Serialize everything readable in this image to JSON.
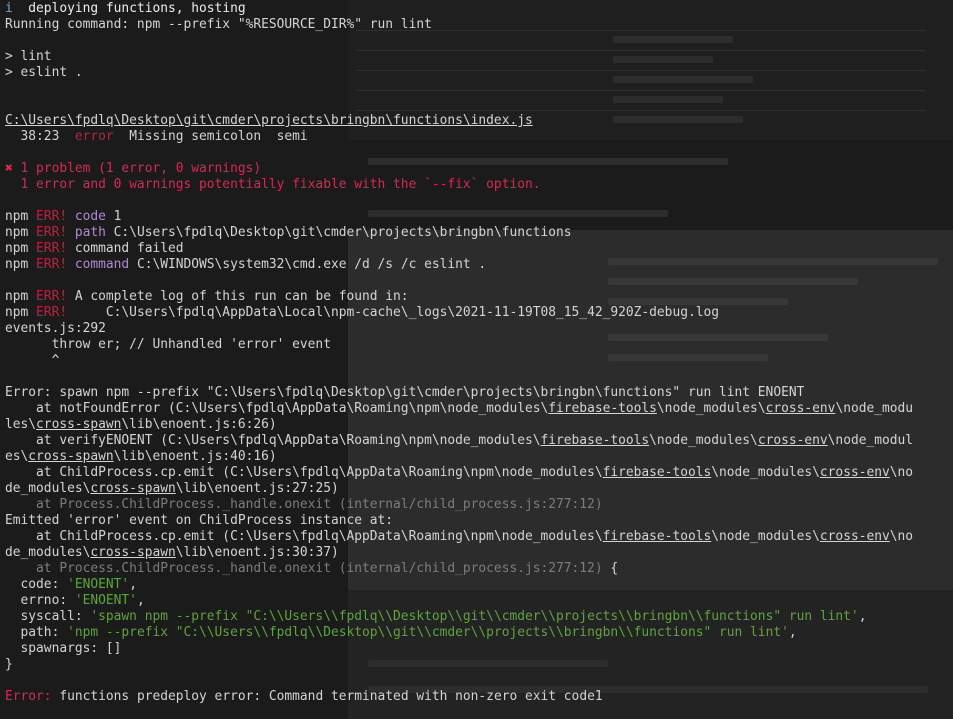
{
  "terminal": {
    "lines": [
      [
        {
          "t": "i",
          "c": "cyan"
        },
        {
          "t": "  deploying ",
          "c": "white"
        },
        {
          "t": "functions, hosting",
          "c": "white"
        }
      ],
      [
        {
          "t": "Running command: npm --prefix \"%RESOURCE_DIR%\" run lint",
          "c": "default"
        }
      ],
      [],
      [
        {
          "t": "> lint",
          "c": "default"
        }
      ],
      [
        {
          "t": "> eslint .",
          "c": "default"
        }
      ],
      [],
      [],
      [
        {
          "t": "C:\\Users\\fpdlq\\Desktop\\git\\cmder\\projects\\bringbn\\functions\\index.js",
          "c": "default",
          "u": true
        }
      ],
      [
        {
          "t": "  38:23  ",
          "c": "default"
        },
        {
          "t": "error",
          "c": "dimred"
        },
        {
          "t": "  Missing semicolon  semi",
          "c": "default"
        }
      ],
      [],
      [
        {
          "t": "✖ 1 problem (1 error, 0 warnings)",
          "c": "red"
        }
      ],
      [
        {
          "t": "  1 error and 0 warnings potentially fixable with the `--fix` option.",
          "c": "red"
        }
      ],
      [],
      [
        {
          "t": "npm ",
          "c": "default"
        },
        {
          "t": "ERR!",
          "c": "dimred"
        },
        {
          "t": " ",
          "c": "default"
        },
        {
          "t": "code",
          "c": "purple"
        },
        {
          "t": " 1",
          "c": "default"
        }
      ],
      [
        {
          "t": "npm ",
          "c": "default"
        },
        {
          "t": "ERR!",
          "c": "dimred"
        },
        {
          "t": " ",
          "c": "default"
        },
        {
          "t": "path",
          "c": "purple"
        },
        {
          "t": " C:\\Users\\fpdlq\\Desktop\\git\\cmder\\projects\\bringbn\\functions",
          "c": "default"
        }
      ],
      [
        {
          "t": "npm ",
          "c": "default"
        },
        {
          "t": "ERR!",
          "c": "dimred"
        },
        {
          "t": " command failed",
          "c": "default"
        }
      ],
      [
        {
          "t": "npm ",
          "c": "default"
        },
        {
          "t": "ERR!",
          "c": "dimred"
        },
        {
          "t": " ",
          "c": "default"
        },
        {
          "t": "command",
          "c": "purple"
        },
        {
          "t": " C:\\WINDOWS\\system32\\cmd.exe /d /s /c eslint .",
          "c": "default"
        }
      ],
      [],
      [
        {
          "t": "npm ",
          "c": "default"
        },
        {
          "t": "ERR!",
          "c": "dimred"
        },
        {
          "t": " A complete log of this run can be found in:",
          "c": "default"
        }
      ],
      [
        {
          "t": "npm ",
          "c": "default"
        },
        {
          "t": "ERR!",
          "c": "dimred"
        },
        {
          "t": "     C:\\Users\\fpdlq\\AppData\\Local\\npm-cache\\_logs\\2021-11-19T08_15_42_920Z-debug.log",
          "c": "default"
        }
      ],
      [
        {
          "t": "events.js:292",
          "c": "default"
        }
      ],
      [
        {
          "t": "      throw er; // Unhandled 'error' event",
          "c": "default"
        }
      ],
      [
        {
          "t": "      ^",
          "c": "default"
        }
      ],
      [],
      [
        {
          "t": "Error: spawn npm --prefix \"C:\\Users\\fpdlq\\Desktop\\git\\cmder\\projects\\bringbn\\functions\" run lint ENOENT",
          "c": "default"
        }
      ],
      [
        {
          "t": "    at notFoundError (C:\\Users\\fpdlq\\AppData\\Roaming\\npm\\node_modules\\",
          "c": "default"
        },
        {
          "t": "firebase-tools",
          "c": "default",
          "u": true
        },
        {
          "t": "\\node_modules\\",
          "c": "default"
        },
        {
          "t": "cross-env",
          "c": "default",
          "u": true
        },
        {
          "t": "\\node_modu",
          "c": "default"
        }
      ],
      [
        {
          "t": "les\\",
          "c": "default"
        },
        {
          "t": "cross-spawn",
          "c": "default",
          "u": true
        },
        {
          "t": "\\lib\\enoent.js:6:26)",
          "c": "default"
        }
      ],
      [
        {
          "t": "    at verifyENOENT (C:\\Users\\fpdlq\\AppData\\Roaming\\npm\\node_modules\\",
          "c": "default"
        },
        {
          "t": "firebase-tools",
          "c": "default",
          "u": true
        },
        {
          "t": "\\node_modules\\",
          "c": "default"
        },
        {
          "t": "cross-env",
          "c": "default",
          "u": true
        },
        {
          "t": "\\node_modul",
          "c": "default"
        }
      ],
      [
        {
          "t": "es\\",
          "c": "default"
        },
        {
          "t": "cross-spawn",
          "c": "default",
          "u": true
        },
        {
          "t": "\\lib\\enoent.js:40:16)",
          "c": "default"
        }
      ],
      [
        {
          "t": "    at ChildProcess.cp.emit (C:\\Users\\fpdlq\\AppData\\Roaming\\npm\\node_modules\\",
          "c": "default"
        },
        {
          "t": "firebase-tools",
          "c": "default",
          "u": true
        },
        {
          "t": "\\node_modules\\",
          "c": "default"
        },
        {
          "t": "cross-env",
          "c": "default",
          "u": true
        },
        {
          "t": "\\no",
          "c": "default"
        }
      ],
      [
        {
          "t": "de_modules\\",
          "c": "default"
        },
        {
          "t": "cross-spawn",
          "c": "default",
          "u": true
        },
        {
          "t": "\\lib\\enoent.js:27:25)",
          "c": "default"
        }
      ],
      [
        {
          "t": "    at Process.ChildProcess._handle.onexit (internal/child_process.js:277:12)",
          "c": "gray"
        }
      ],
      [
        {
          "t": "Emitted 'error' event on ChildProcess instance at:",
          "c": "default"
        }
      ],
      [
        {
          "t": "    at ChildProcess.cp.emit (C:\\Users\\fpdlq\\AppData\\Roaming\\npm\\node_modules\\",
          "c": "default"
        },
        {
          "t": "firebase-tools",
          "c": "default",
          "u": true
        },
        {
          "t": "\\node_modules\\",
          "c": "default"
        },
        {
          "t": "cross-env",
          "c": "default",
          "u": true
        },
        {
          "t": "\\no",
          "c": "default"
        }
      ],
      [
        {
          "t": "de_modules\\",
          "c": "default"
        },
        {
          "t": "cross-spawn",
          "c": "default",
          "u": true
        },
        {
          "t": "\\lib\\enoent.js:30:37)",
          "c": "default"
        }
      ],
      [
        {
          "t": "    at Process.ChildProcess._handle.onexit (internal/child_process.js:277:12)",
          "c": "gray"
        },
        {
          "t": " {",
          "c": "default"
        }
      ],
      [
        {
          "t": "  code: ",
          "c": "default"
        },
        {
          "t": "'ENOENT'",
          "c": "green"
        },
        {
          "t": ",",
          "c": "default"
        }
      ],
      [
        {
          "t": "  errno: ",
          "c": "default"
        },
        {
          "t": "'ENOENT'",
          "c": "green"
        },
        {
          "t": ",",
          "c": "default"
        }
      ],
      [
        {
          "t": "  syscall: ",
          "c": "default"
        },
        {
          "t": "'spawn npm --prefix \"C:\\\\Users\\\\fpdlq\\\\Desktop\\\\git\\\\cmder\\\\projects\\\\bringbn\\\\functions\" run lint'",
          "c": "green"
        },
        {
          "t": ",",
          "c": "default"
        }
      ],
      [
        {
          "t": "  path: ",
          "c": "default"
        },
        {
          "t": "'npm --prefix \"C:\\\\Users\\\\fpdlq\\\\Desktop\\\\git\\\\cmder\\\\projects\\\\bringbn\\\\functions\" run lint'",
          "c": "green"
        },
        {
          "t": ",",
          "c": "default"
        }
      ],
      [
        {
          "t": "  spawnargs: []",
          "c": "default"
        }
      ],
      [
        {
          "t": "}",
          "c": "default"
        }
      ],
      [],
      [
        {
          "t": "Error:",
          "c": "red"
        },
        {
          "t": " functions predeploy error: Command terminated with non-zero exit code1",
          "c": "default"
        }
      ]
    ]
  }
}
